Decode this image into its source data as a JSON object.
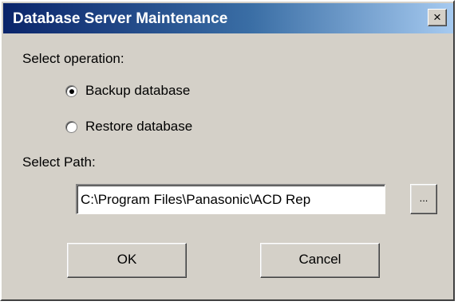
{
  "window": {
    "title": "Database Server Maintenance",
    "close_label": "×"
  },
  "operation": {
    "label": "Select operation:",
    "options": [
      {
        "label": "Backup database",
        "selected": true
      },
      {
        "label": "Restore database",
        "selected": false
      }
    ]
  },
  "path": {
    "label": "Select Path:",
    "value": "C:\\Program Files\\Panasonic\\ACD Rep",
    "browse_label": "..."
  },
  "buttons": {
    "ok_label": "OK",
    "cancel_label": "Cancel"
  },
  "colors": {
    "dialog_face": "#d4d0c8",
    "title_start": "#0a246a",
    "title_end": "#a6caf0"
  }
}
